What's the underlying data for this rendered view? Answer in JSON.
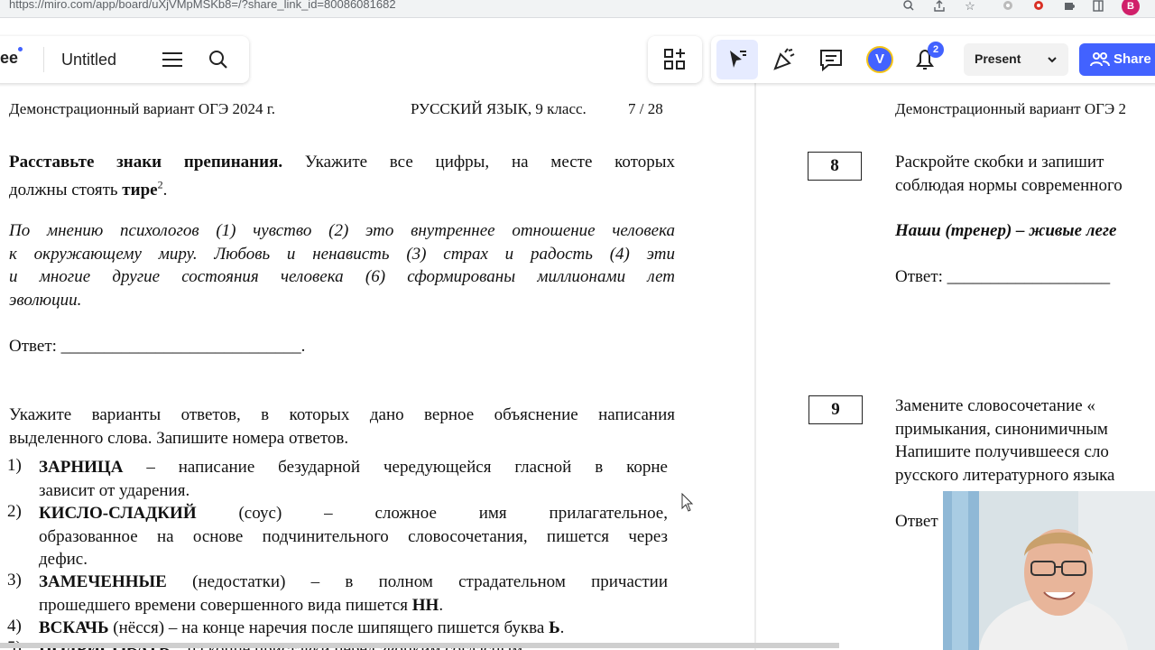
{
  "browser": {
    "url": "https://miro.com/app/board/uXjVMpMSKb8=/?share_link_id=80086081682",
    "profile_initial": "B",
    "icons": [
      "zoom-icon",
      "share-page-icon",
      "bookmark-star-icon",
      "chrome-icon",
      "extension-red-icon",
      "puzzle-icon",
      "sidepanel-icon"
    ]
  },
  "miro": {
    "logo_fragment": "ee",
    "board_title": "Untitled",
    "avatar_initial": "V",
    "notification_count": "2",
    "present_label": "Present",
    "share_label": "Share",
    "accent_color": "#4262ff"
  },
  "left_page": {
    "header_left": "Демонстрационный вариант ОГЭ 2024 г.",
    "header_right": "РУССКИЙ ЯЗЫК, 9 класс.",
    "page_num": "7 / 28",
    "task_bold": "Расставьте знаки препинания.",
    "task_line1_rest": "Укажите все цифры, на месте которых",
    "task_line2_pre": "должны стоять",
    "task_line2_bold": "тире",
    "task_line2_sup": "2",
    "task_line2_end": ".",
    "sentence_lines": [
      "По мнению психологов (1) чувство (2) это внутреннее отношение человека",
      "к окружающему миру. Любовь и ненависть (3) страх и радость (4) эти",
      "и многие другие состояния человека (6) сформированы миллионами лет",
      "эволюции."
    ],
    "answer": "Ответ: ____________________________.",
    "task2_lines": [
      "Укажите варианты ответов, в которых дано верное объяснение написания",
      "выделенного слова. Запишите номера ответов."
    ],
    "options": [
      {
        "num": "1)",
        "word": "ЗАРНИЦА",
        "rest1": " – написание безударной чередующейся гласной в корне",
        "rest2": "зависит от ударения."
      },
      {
        "num": "2)",
        "word": "КИСЛО-СЛАДКИЙ",
        "rest1": " (соус) – сложное имя прилагательное,",
        "rest2": "образованное на основе подчинительного словосочетания, пишется через",
        "rest3": "дефис."
      },
      {
        "num": "3)",
        "word": "ЗАМЕЧЕННЫЕ",
        "rest1": " (недостатки) – в полном страдательном причастии",
        "rest2_pre": "прошедшего времени совершенного вида пишется ",
        "rest2_bold": "НН",
        "rest2_end": "."
      },
      {
        "num": "4)",
        "word": "ВСКАЧЬ",
        "rest1_pre": " (нёсся) – на конце наречия после шипящего пишется буква ",
        "rest1_bold": "Ь",
        "rest1_end": "."
      },
      {
        "num": "5)",
        "word": "ПОДРИСОВАТЬ",
        "rest1": " – на конце приставки перед звонким согласным"
      }
    ]
  },
  "right_page": {
    "header_left": "Демонстрационный вариант ОГЭ 2",
    "task8_num": "8",
    "task8_lines": [
      "Раскройте скобки и запишит",
      "соблюдая нормы современного"
    ],
    "task8_example": "Наши (тренер) – живые леге",
    "task8_answer": "Ответ: ___________________",
    "task9_num": "9",
    "task9_lines": [
      "Замените словосочетание «",
      "примыкания, синонимичным",
      "Напишите получившееся сло",
      "русского литературного языка"
    ],
    "task9_answer": "Ответ"
  }
}
